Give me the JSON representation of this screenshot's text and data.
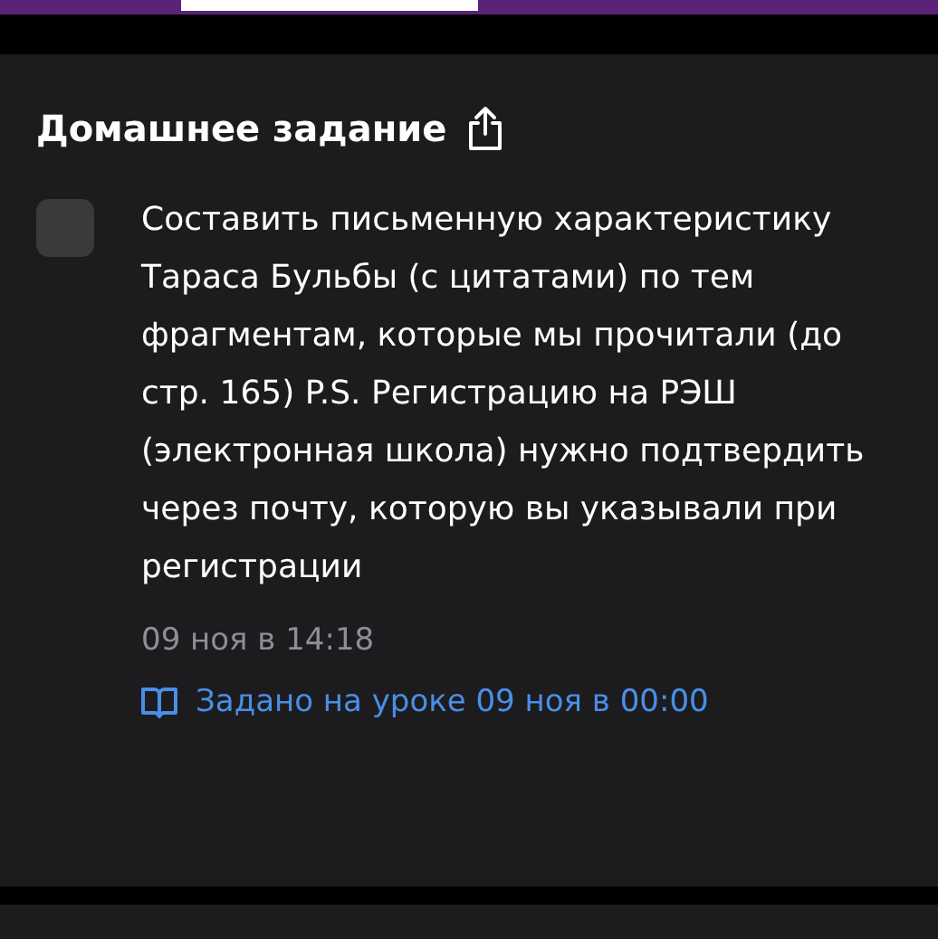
{
  "title": "Домашнее задание",
  "task": {
    "checked": false,
    "text": "Составить письменную характеристику Тараса Бульбы (с цитатами) по тем фрагментам, которые мы прочитали (до стр. 165) P.S. Регистрацию на РЭШ (электронная школа) нужно подтвердить через почту, которую вы указывали при регистрации",
    "date": "09 ноя в 14:18",
    "lesson_link": "Задано на уроке 09 ноя в 00:00"
  }
}
